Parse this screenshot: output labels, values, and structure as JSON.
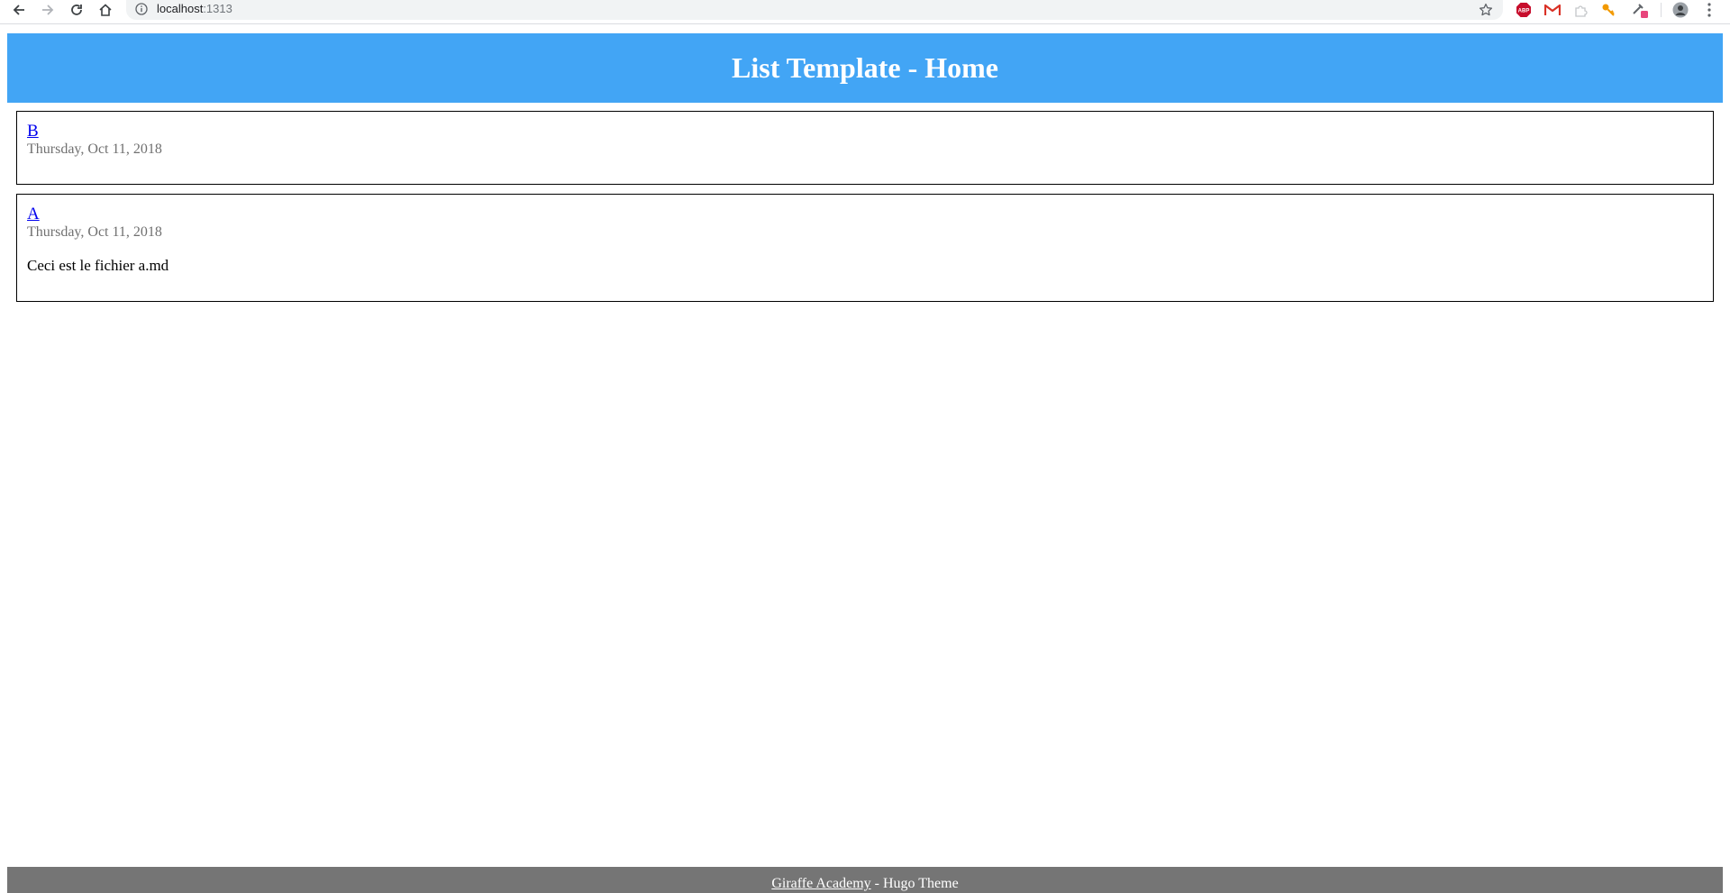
{
  "browser": {
    "url_host": "localhost",
    "url_port": ":1313",
    "icons": {
      "back": "back-arrow-icon",
      "forward": "forward-arrow-icon",
      "reload": "reload-icon",
      "home": "home-icon",
      "info": "info-icon",
      "bookmark": "star-icon",
      "adblock_label": "ABP",
      "menu": "kebab-menu-icon"
    },
    "colors": {
      "abp": "#c70d2c",
      "gmail": "#d93025",
      "key": "#f29900",
      "badge": "#e8457c"
    }
  },
  "header": {
    "title": "List Template - Home",
    "background": "#42a5f5"
  },
  "posts": [
    {
      "title": "B",
      "date": "Thursday, Oct 11, 2018",
      "summary": ""
    },
    {
      "title": "A",
      "date": "Thursday, Oct 11, 2018",
      "summary": "Ceci est le fichier a.md"
    }
  ],
  "footer": {
    "link_text": "Giraffe Academy",
    "suffix": " - Hugo Theme",
    "background": "#757575"
  }
}
